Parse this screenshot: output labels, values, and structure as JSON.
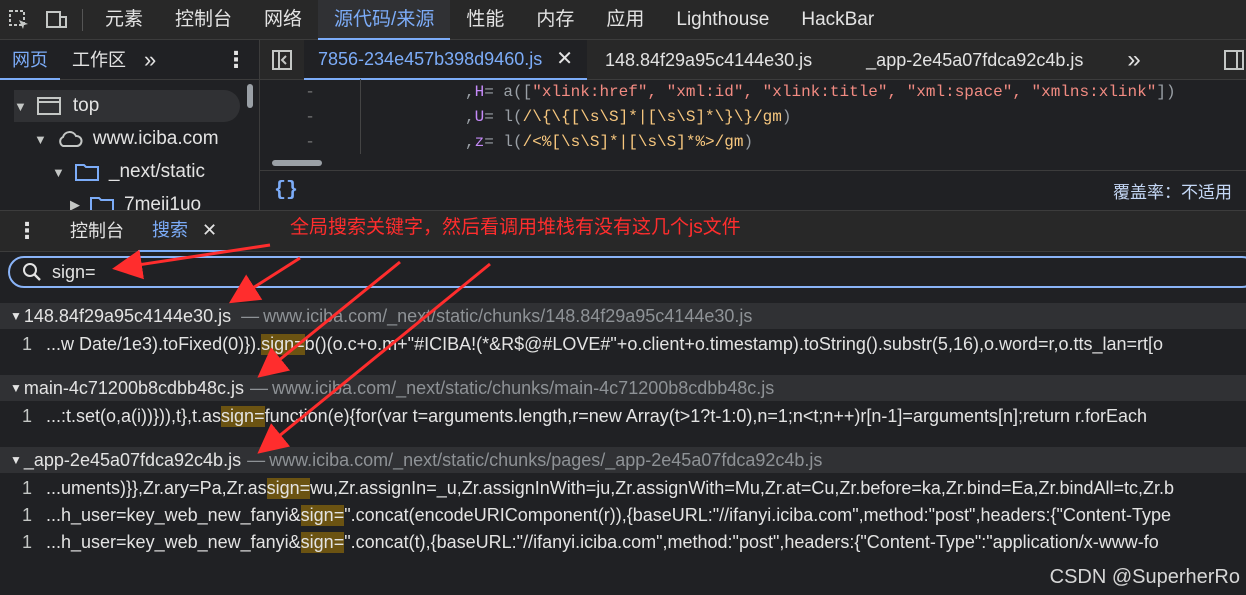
{
  "toolbar": {
    "tabs": [
      "元素",
      "控制台",
      "网络",
      "源代码/来源",
      "性能",
      "内存",
      "应用",
      "Lighthouse",
      "HackBar"
    ],
    "active_tab": "源代码/来源"
  },
  "navigator": {
    "tabs": [
      "网页",
      "工作区"
    ],
    "more": "»",
    "tree": [
      "top",
      "www.iciba.com",
      "_next/static",
      "7meii1uo"
    ]
  },
  "editor": {
    "tabs": [
      "7856-234e457b398d9460.js",
      "148.84f29a95c4144e30.js",
      "_app-2e45a07fdca92c4b.js"
    ],
    "more": "»",
    "code": [
      {
        "gutter": "-",
        "prefix": ", ",
        "var": "H",
        "eq": " = a([",
        "rest": "\"xlink:href\", \"xml:id\", \"xlink:title\", \"xml:space\", \"xmlns:xlink\"",
        "end": "])"
      },
      {
        "gutter": "-",
        "prefix": ", ",
        "var": "U",
        "eq": " = l(",
        "rest": "/\\{\\{[\\s\\S]*|[\\s\\S]*\\}\\}/gm",
        "end": ")"
      },
      {
        "gutter": "-",
        "prefix": ", ",
        "var": "z",
        "eq": " = l(",
        "rest": "/<%[\\s\\S]*|[\\s\\S]*%>/gm",
        "end": ")"
      }
    ],
    "format_button": "{}",
    "coverage": "覆盖率：不适用"
  },
  "drawer": {
    "tabs": [
      "控制台",
      "搜索"
    ],
    "annotation": "全局搜索关键字，然后看调用堆栈有没有这几个js文件"
  },
  "search": {
    "query": "sign="
  },
  "results": [
    {
      "file": "148.84f29a95c4144e30.js",
      "url": "www.iciba.com/_next/static/chunks/148.84f29a95c4144e30.js",
      "lines": [
        {
          "num": "1",
          "before": "...w Date/1e3).toFixed(0)}).",
          "match": "sign=",
          "after": "b()(o.c+o.m+\"#ICIBA!(*&R$@#LOVE#\"+o.client+o.timestamp).toString().substr(5,16),o.word=r,o.tts_lan=rt[o"
        }
      ]
    },
    {
      "file": "main-4c71200b8cdbb48c.js",
      "url": "www.iciba.com/_next/static/chunks/main-4c71200b8cdbb48c.js",
      "lines": [
        {
          "num": "1",
          "before": "...:t.set(o,a(i))})),t},t.as",
          "match": "sign=",
          "after": "function(e){for(var t=arguments.length,r=new Array(t>1?t-1:0),n=1;n<t;n++)r[n-1]=arguments[n];return r.forEach"
        }
      ]
    },
    {
      "file": "_app-2e45a07fdca92c4b.js",
      "url": "www.iciba.com/_next/static/chunks/pages/_app-2e45a07fdca92c4b.js",
      "lines": [
        {
          "num": "1",
          "before": "...uments)}},Zr.ary=Pa,Zr.as",
          "match": "sign=",
          "after": "wu,Zr.assignIn=_u,Zr.assignInWith=ju,Zr.assignWith=Mu,Zr.at=Cu,Zr.before=ka,Zr.bind=Ea,Zr.bindAll=tc,Zr.b"
        },
        {
          "num": "1",
          "before": "...h_user=key_web_new_fanyi&",
          "match": "sign=",
          "after": "\".concat(encodeURIComponent(r)),{baseURL:\"//ifanyi.iciba.com\",method:\"post\",headers:{\"Content-Type"
        },
        {
          "num": "1",
          "before": "...h_user=key_web_new_fanyi&",
          "match": "sign=",
          "after": "\".concat(t),{baseURL:\"//ifanyi.iciba.com\",method:\"post\",headers:{\"Content-Type\":\"application/x-www-fo"
        }
      ]
    }
  ],
  "watermark": "CSDN @SuperherRo",
  "colors": {
    "accent": "#7cacf8",
    "annotation": "#ff2d2d",
    "highlight": "#6b5312"
  }
}
